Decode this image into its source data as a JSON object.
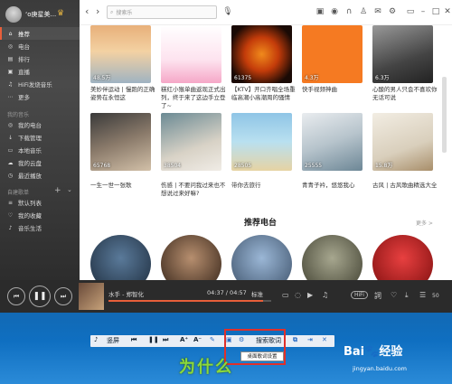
{
  "sidebar": {
    "username": "‘o庚星美...",
    "items": [
      {
        "label": "推荐",
        "icon": "home-icon",
        "active": true
      },
      {
        "label": "电台",
        "icon": "radio-icon"
      },
      {
        "label": "排行",
        "icon": "rank-icon"
      },
      {
        "label": "直播",
        "icon": "live-icon"
      },
      {
        "label": "HiFi发烧音乐",
        "icon": "hifi-icon"
      },
      {
        "label": "更多",
        "icon": "more-icon"
      }
    ],
    "my_music_title": "我的音乐",
    "my_music": [
      {
        "label": "我的电台",
        "icon": "radio-icon"
      },
      {
        "label": "下载管理",
        "icon": "download-icon"
      },
      {
        "label": "本地音乐",
        "icon": "folder-icon"
      },
      {
        "label": "我的云盘",
        "icon": "cloud-icon"
      },
      {
        "label": "最近播放",
        "icon": "clock-icon"
      }
    ],
    "playlists_title": "自建歌单",
    "playlists": [
      {
        "label": "默认列表",
        "icon": "list-icon"
      },
      {
        "label": "我的收藏",
        "icon": "heart-icon"
      },
      {
        "label": "音乐生活",
        "icon": "music-icon"
      }
    ]
  },
  "topbar": {
    "search_placeholder": "搜索乐"
  },
  "grid": [
    {
      "count": "48.5万",
      "caption": "美妙伴运动 | 慢跑的正确姿势在永恒这"
    },
    {
      "count": "",
      "caption": "糕红小猴单曲返现正式出列，终于来了这边手立登了~"
    },
    {
      "count": "61375",
      "caption": "【KTV】开口齐唱全场重临高潮小高潮周的骚情"
    },
    {
      "count": "4.3万",
      "caption": "快手视频神曲"
    },
    {
      "count": "6.3万",
      "caption": "心酸的男人只会不喜欢你无话可说"
    },
    {
      "count": "65768",
      "caption": "一生一世一张歌"
    },
    {
      "count": "38504",
      "caption": "伤感 | 不要问我过来也不想说过来好嘛?"
    },
    {
      "count": "28505",
      "caption": "带你去旅行"
    },
    {
      "count": "25555",
      "caption": "青青子衿，悠悠我心"
    },
    {
      "count": "15.8万",
      "caption": "古风 | 古风歌曲精选大全"
    }
  ],
  "radio_section": {
    "title": "推荐电台",
    "more": "更多 >"
  },
  "player": {
    "song": "水手 - 郑智化",
    "time": "04:37 / 04:57",
    "quality": "标准",
    "progress": 0.95,
    "hifi": "HiFi",
    "count": "50"
  },
  "lyric_bar": {
    "labels": [
      "竖屏",
      "A⁺",
      "A⁻",
      "搜索歌词"
    ],
    "tooltip": "桌面歌词设置",
    "lyric": "为什么"
  },
  "watermark": {
    "brand": "Bai🐾经验",
    "url": "jingyan.baidu.com"
  },
  "colors": {
    "accent": "#e85f3a",
    "highlight": "#e0302a",
    "lyric": "#8bd93b"
  }
}
